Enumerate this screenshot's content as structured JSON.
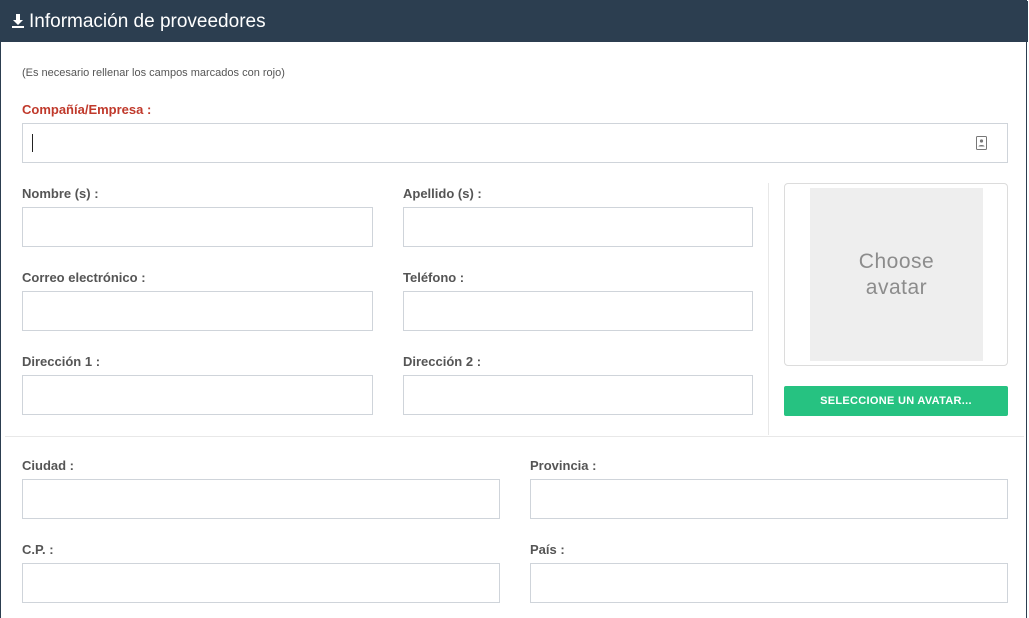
{
  "header": {
    "title": "Información de proveedores",
    "icon": "download-icon",
    "bg_color": "#2c3e50"
  },
  "note": "(Es necesario rellenar los campos marcados con rojo)",
  "required_color": "#c0392b",
  "fields": {
    "company": {
      "label": "Compañía/Empresa :",
      "value": ""
    },
    "first_name": {
      "label": "Nombre (s) :",
      "value": ""
    },
    "last_name": {
      "label": "Apellido (s) :",
      "value": ""
    },
    "email": {
      "label": "Correo electrónico :",
      "value": ""
    },
    "phone": {
      "label": "Teléfono :",
      "value": ""
    },
    "address1": {
      "label": "Dirección 1 :",
      "value": ""
    },
    "address2": {
      "label": "Dirección 2 :",
      "value": ""
    },
    "city": {
      "label": "Ciudad :",
      "value": ""
    },
    "province": {
      "label": "Provincia :",
      "value": ""
    },
    "zip": {
      "label": "C.P. :",
      "value": ""
    },
    "country": {
      "label": "País :",
      "value": ""
    }
  },
  "avatar": {
    "placeholder_line1": "Choose",
    "placeholder_line2": "avatar",
    "button_label": "SELECCIONE UN AVATAR...",
    "button_color": "#26c281"
  }
}
